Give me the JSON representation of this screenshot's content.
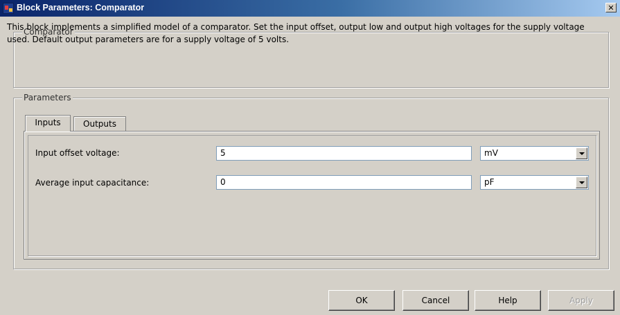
{
  "window": {
    "title": "Block Parameters: Comparator",
    "close_glyph": "✕"
  },
  "description_group": {
    "legend": "Comparator",
    "text": "This block implements a simplified model of a comparator. Set the input offset, output low and output high voltages for the supply voltage used. Default output parameters are for a supply voltage of 5 volts."
  },
  "parameters_group": {
    "legend": "Parameters",
    "tabs": [
      {
        "label": "Inputs",
        "active": true
      },
      {
        "label": "Outputs",
        "active": false
      }
    ],
    "fields": [
      {
        "label": "Input offset voltage:",
        "value": "5",
        "unit": "mV"
      },
      {
        "label": "Average input capacitance:",
        "value": "0",
        "unit": "pF"
      }
    ]
  },
  "buttons": {
    "ok": "OK",
    "cancel": "Cancel",
    "help": "Help",
    "apply": "Apply"
  },
  "icons": {
    "window_icon": "simulink-block-icon",
    "close": "close-icon",
    "dropdown": "chevron-down-icon"
  }
}
